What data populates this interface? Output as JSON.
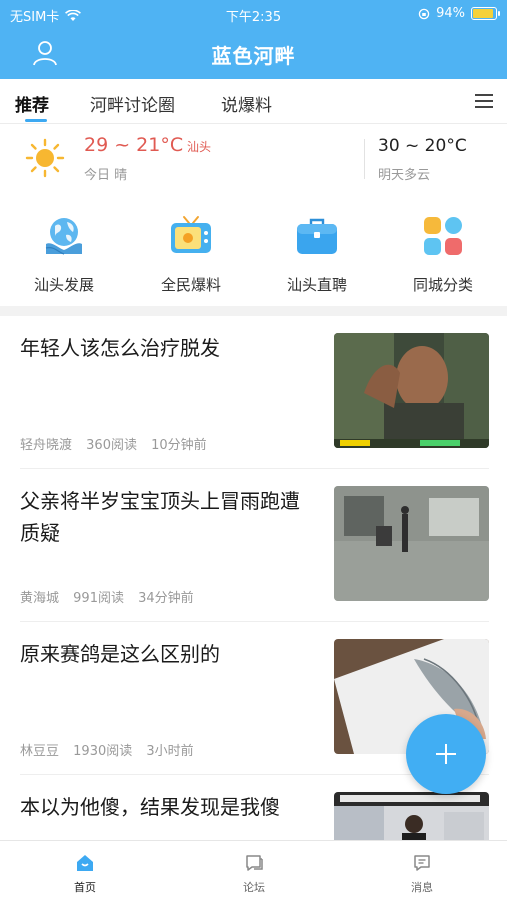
{
  "status_bar": {
    "carrier": "无SIM卡",
    "time": "下午2:35",
    "battery_pct": "94%",
    "battery_level": 0.94
  },
  "header": {
    "title": "蓝色河畔",
    "user_icon": "user-icon"
  },
  "tabs": [
    {
      "label": "推荐",
      "active": true
    },
    {
      "label": "河畔讨论圈",
      "active": false
    },
    {
      "label": "说爆料",
      "active": false
    }
  ],
  "weather": {
    "today_temp": "29 ~ 21°C",
    "city": "汕头",
    "today_desc": "今日 晴",
    "tomorrow_temp": "30 ~ 20°C",
    "tomorrow_desc": "明天多云"
  },
  "quick_entries": [
    {
      "label": "汕头发展",
      "icon": "globe-hands-icon"
    },
    {
      "label": "全民爆料",
      "icon": "tv-icon"
    },
    {
      "label": "汕头直聘",
      "icon": "briefcase-icon"
    },
    {
      "label": "同城分类",
      "icon": "category-grid-icon"
    }
  ],
  "news": [
    {
      "title": "年轻人该怎么治疗脱发",
      "author": "轻舟晓渡",
      "reads": "360阅读",
      "time": "10分钟前",
      "thumb": "man-portrait-thumb"
    },
    {
      "title": "父亲将半岁宝宝顶头上冒雨跑遭质疑",
      "author": "黄海城",
      "reads": "991阅读",
      "time": "34分钟前",
      "thumb": "street-cctv-thumb"
    },
    {
      "title": "原来赛鸽是这么区别的",
      "author": "林豆豆",
      "reads": "1930阅读",
      "time": "3小时前",
      "thumb": "pigeon-wing-thumb"
    },
    {
      "title": "本以为他傻，结果发现是我傻",
      "author": "",
      "reads": "",
      "time": "",
      "thumb": "store-thumb"
    }
  ],
  "bottom_nav": [
    {
      "label": "首页",
      "active": true
    },
    {
      "label": "论坛",
      "active": false
    },
    {
      "label": "消息",
      "active": false
    }
  ],
  "colors": {
    "brand": "#4fb3f3",
    "accent": "#3da9f2",
    "weather_red": "#e05a52"
  }
}
